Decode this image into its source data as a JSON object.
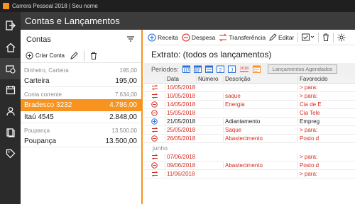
{
  "window": {
    "title": "Carrera Pessoal 2018 | Seu nome"
  },
  "header": {
    "title": "Contas e Lançamentos"
  },
  "nav": [
    {
      "icon": "sign-out-icon",
      "active": false
    },
    {
      "icon": "home-icon",
      "active": false
    },
    {
      "icon": "accounts-icon",
      "active": true
    },
    {
      "icon": "calendar-icon",
      "active": false
    },
    {
      "icon": "people-icon",
      "active": false
    },
    {
      "icon": "book-icon",
      "active": false
    },
    {
      "icon": "tag-icon",
      "active": false
    }
  ],
  "accounts_panel": {
    "title": "Contas",
    "create_label": "Criar Conta",
    "groups": [
      {
        "name": "Dinheiro, Carteira",
        "total": "195,00",
        "accounts": [
          {
            "name": "Carteira",
            "balance": "195,00",
            "selected": false
          }
        ]
      },
      {
        "name": "Conta corrente",
        "total": "7.634,00",
        "accounts": [
          {
            "name": "Bradesco 3232",
            "balance": "4.786,00",
            "selected": true
          },
          {
            "name": "Itaú 4545",
            "balance": "2.848,00",
            "selected": false
          }
        ]
      },
      {
        "name": "Poupança",
        "total": "13.500,00",
        "accounts": [
          {
            "name": "Poupança",
            "balance": "13.500,00",
            "selected": false
          }
        ]
      }
    ]
  },
  "toolbar": {
    "receita": "Receita",
    "despesa": "Despesa",
    "transferencia": "Transferência",
    "editar": "Editar"
  },
  "extrato": {
    "title": "Extrato: (todos os lançamentos)"
  },
  "periods": {
    "label": "Períodos:",
    "icon_labels": [
      "",
      "",
      "",
      "2",
      "J",
      "2018",
      ""
    ],
    "lancamentos_button": "Lançamentos Agendados"
  },
  "table": {
    "columns": [
      "Data",
      "Número",
      "Descrição",
      "Favorecido"
    ],
    "rows": [
      {
        "type": "transfer",
        "date": "10/05/2018",
        "num": "",
        "desc": "",
        "fav": "> para:",
        "red": true
      },
      {
        "type": "transfer",
        "date": "10/05/2018",
        "num": "",
        "desc": "saque",
        "fav": "> para:",
        "red": true
      },
      {
        "type": "expense",
        "date": "14/05/2018",
        "num": "",
        "desc": "Energia",
        "fav": "Cia de E",
        "red": true
      },
      {
        "type": "expense",
        "date": "15/05/2018",
        "num": "",
        "desc": "",
        "fav": "Cia Tele",
        "red": true
      },
      {
        "type": "income",
        "date": "21/05/2018",
        "num": "",
        "desc": "Adiantamento",
        "fav": "Empreg",
        "red": false
      },
      {
        "type": "transfer",
        "date": "25/05/2018",
        "num": "",
        "desc": "Saque",
        "fav": "> para:",
        "red": true
      },
      {
        "type": "expense",
        "date": "26/05/2018",
        "num": "",
        "desc": "Abastecimento",
        "fav": "Posto d",
        "red": true
      }
    ],
    "month2": "junho",
    "rows2": [
      {
        "type": "transfer",
        "date": "07/06/2018",
        "num": "",
        "desc": "",
        "fav": "> para:",
        "red": true
      },
      {
        "type": "expense",
        "date": "09/06/2018",
        "num": "",
        "desc": "Abastecimento",
        "fav": "Posto d",
        "red": true
      },
      {
        "type": "transfer",
        "date": "11/06/2018",
        "num": "",
        "desc": "",
        "fav": "> para:",
        "red": true
      }
    ]
  },
  "colors": {
    "accent": "#f7931e",
    "expense": "#d52b1e",
    "income": "#2a6fd6",
    "transfer": "#d52b1e"
  }
}
